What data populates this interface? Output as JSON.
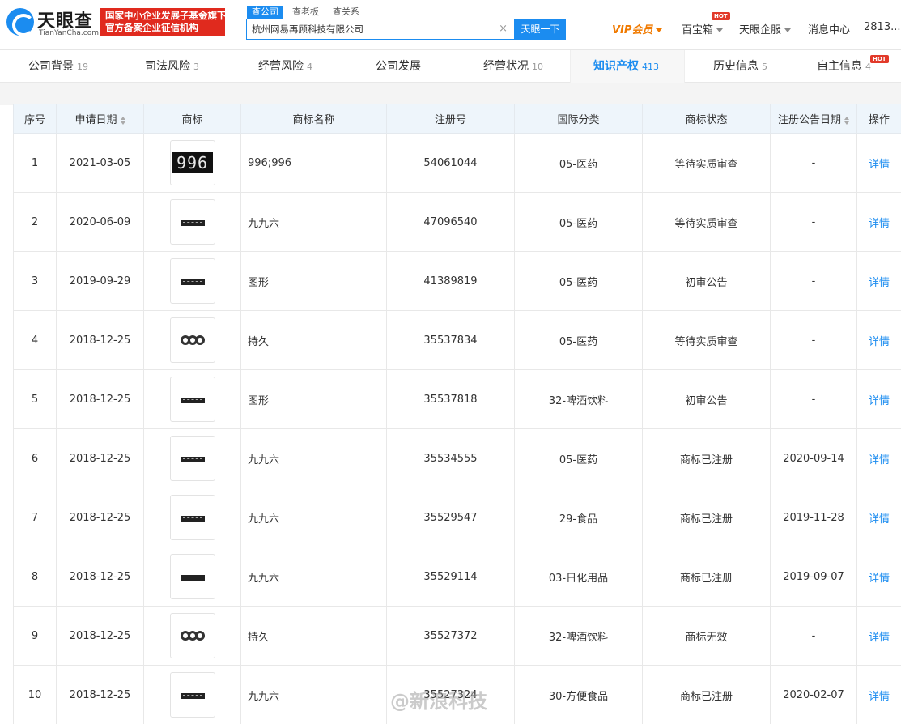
{
  "header": {
    "logo_main": "天眼查",
    "logo_sub": "TianYanCha.com",
    "slogan_line1": "国家中小企业发展子基金旗下",
    "slogan_line2": "官方备案企业征信机构",
    "search_tabs": [
      "查公司",
      "查老板",
      "查关系"
    ],
    "search_value": "杭州网易再顾科技有限公司",
    "search_clear": "×",
    "search_button": "天眼一下",
    "vip": "VIP会员",
    "baibao": "百宝箱",
    "hot": "HOT",
    "qiye": "天眼企服",
    "messages": "消息中心",
    "phone_partial": "2813..."
  },
  "tabs": [
    {
      "label": "公司背景",
      "count": "19"
    },
    {
      "label": "司法风险",
      "count": "3"
    },
    {
      "label": "经营风险",
      "count": "4"
    },
    {
      "label": "公司发展",
      "count": ""
    },
    {
      "label": "经营状况",
      "count": "10"
    },
    {
      "label": "知识产权",
      "count": "413"
    },
    {
      "label": "历史信息",
      "count": "5"
    },
    {
      "label": "自主信息",
      "count": "4"
    }
  ],
  "table": {
    "headers": [
      "序号",
      "申请日期",
      "商标",
      "商标名称",
      "注册号",
      "国际分类",
      "商标状态",
      "注册公告日期",
      "操作"
    ],
    "rows": [
      {
        "no": "1",
        "date": "2021-03-05",
        "logo": "996",
        "name": "996;996",
        "reg": "54061044",
        "cls": "05-医药",
        "status": "等待实质审查",
        "pub": "-",
        "op": "详情"
      },
      {
        "no": "2",
        "date": "2020-06-09",
        "logo": "bar",
        "name": "九九六",
        "reg": "47096540",
        "cls": "05-医药",
        "status": "等待实质审查",
        "pub": "-",
        "op": "详情"
      },
      {
        "no": "3",
        "date": "2019-09-29",
        "logo": "bar",
        "name": "图形",
        "reg": "41389819",
        "cls": "05-医药",
        "status": "初审公告",
        "pub": "-",
        "op": "详情"
      },
      {
        "no": "4",
        "date": "2018-12-25",
        "logo": "rings",
        "name": "持久",
        "reg": "35537834",
        "cls": "05-医药",
        "status": "等待实质审查",
        "pub": "-",
        "op": "详情"
      },
      {
        "no": "5",
        "date": "2018-12-25",
        "logo": "bar",
        "name": "图形",
        "reg": "35537818",
        "cls": "32-啤酒饮料",
        "status": "初审公告",
        "pub": "-",
        "op": "详情"
      },
      {
        "no": "6",
        "date": "2018-12-25",
        "logo": "bar",
        "name": "九九六",
        "reg": "35534555",
        "cls": "05-医药",
        "status": "商标已注册",
        "pub": "2020-09-14",
        "op": "详情"
      },
      {
        "no": "7",
        "date": "2018-12-25",
        "logo": "bar",
        "name": "九九六",
        "reg": "35529547",
        "cls": "29-食品",
        "status": "商标已注册",
        "pub": "2019-11-28",
        "op": "详情"
      },
      {
        "no": "8",
        "date": "2018-12-25",
        "logo": "bar",
        "name": "九九六",
        "reg": "35529114",
        "cls": "03-日化用品",
        "status": "商标已注册",
        "pub": "2019-09-07",
        "op": "详情"
      },
      {
        "no": "9",
        "date": "2018-12-25",
        "logo": "rings",
        "name": "持久",
        "reg": "35527372",
        "cls": "32-啤酒饮料",
        "status": "商标无效",
        "pub": "-",
        "op": "详情"
      },
      {
        "no": "10",
        "date": "2018-12-25",
        "logo": "bar",
        "name": "九九六",
        "reg": "35527324",
        "cls": "30-方便食品",
        "status": "商标已注册",
        "pub": "2020-02-07",
        "op": "详情"
      }
    ]
  },
  "watermark": "@新浪科技",
  "colors": {
    "brand": "#1b8cf0",
    "vip": "#f07a00",
    "slogan": "#e02a1e",
    "header_bg": "#eef5fb"
  }
}
